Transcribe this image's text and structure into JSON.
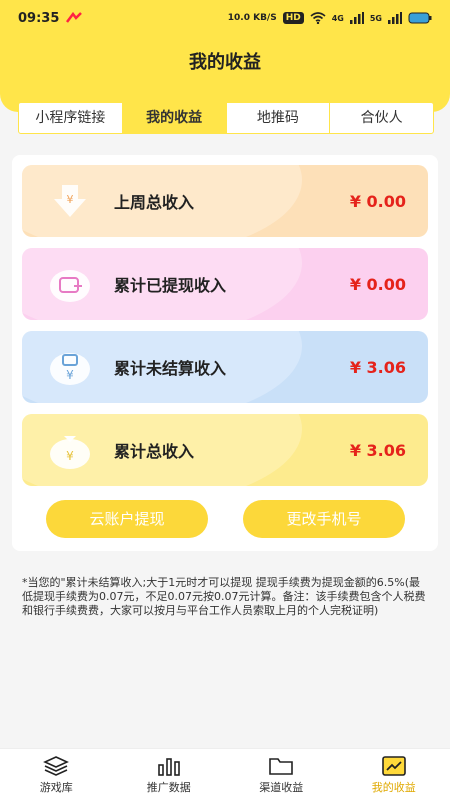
{
  "status_bar": {
    "time": "09:35",
    "network_speed": "10.0 KB/S",
    "hd_badge": "HD",
    "signal_left": "4G",
    "signal_right": "5G"
  },
  "header": {
    "title": "我的收益"
  },
  "tabs": [
    {
      "label": "小程序链接",
      "active": false
    },
    {
      "label": "我的收益",
      "active": true
    },
    {
      "label": "地推码",
      "active": false
    },
    {
      "label": "合伙人",
      "active": false
    }
  ],
  "stats": [
    {
      "label": "上周总收入",
      "value": "¥ 0.00",
      "icon": "arrow-down-yen-icon"
    },
    {
      "label": "累计已提现收入",
      "value": "¥ 0.00",
      "icon": "wallet-plus-icon"
    },
    {
      "label": "累计未结算收入",
      "value": "¥ 3.06",
      "icon": "yen-bag-icon"
    },
    {
      "label": "累计总收入",
      "value": "¥ 3.06",
      "icon": "money-bag-icon"
    }
  ],
  "buttons": {
    "withdraw_label": "云账户提现",
    "change_phone_label": "更改手机号"
  },
  "note": "*当您的\"累计未结算收入;大于1元时才可以提现 提现手续费为提现金额的6.5%(最低提现手续费为0.07元，不足0.07元按0.07元计算。备注：该手续费包含个人税费和银行手续费费，大家可以按月与平台工作人员索取上月的个人完税证明)",
  "bottom_nav": [
    {
      "label": "游戏库",
      "icon": "layers-icon",
      "active": false
    },
    {
      "label": "推广数据",
      "icon": "bar-chart-icon",
      "active": false
    },
    {
      "label": "渠道收益",
      "icon": "folder-icon",
      "active": false
    },
    {
      "label": "我的收益",
      "icon": "trend-chart-icon",
      "active": true
    }
  ],
  "colors": {
    "accent": "#ffe54a",
    "value_red": "#e5231b",
    "button_yellow": "#fcd83a"
  }
}
